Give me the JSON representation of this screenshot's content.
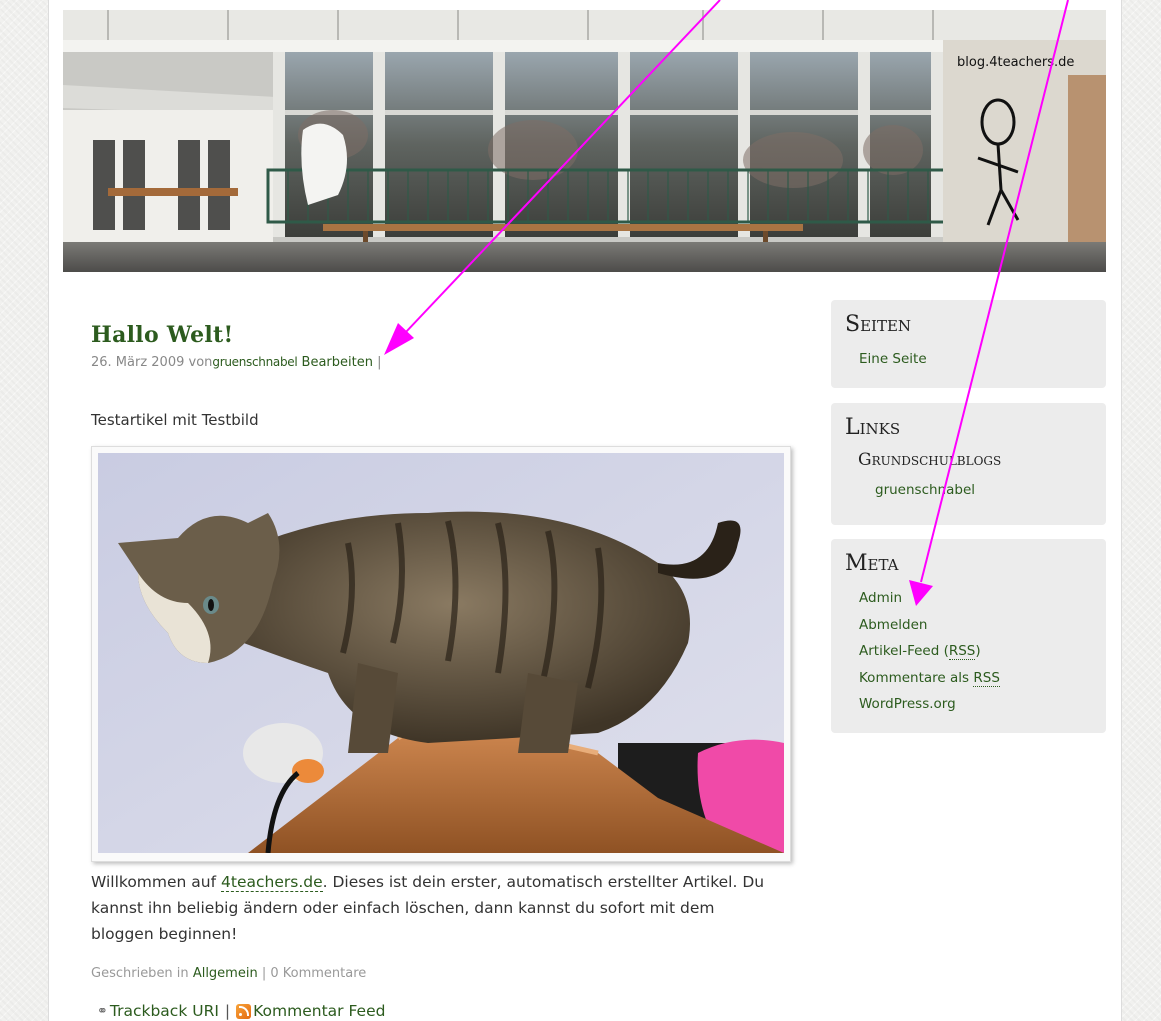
{
  "header": {
    "blog_name": "blog.4teachers.de"
  },
  "post": {
    "title": "Hallo Welt!",
    "date": "26. März 2009",
    "by": "von",
    "author": "gruenschnabel",
    "edit_label": "Bearbeiten",
    "meta_sep": "|",
    "intro": "Testartikel mit Testbild",
    "body_prefix": "Willkommen auf ",
    "body_link": "4teachers.de",
    "body_suffix": ". Dieses ist dein erster, automatisch erstellter Artikel. Du kannst ihn beliebig ändern oder einfach löschen, dann kannst du sofort mit dem bloggen beginnen!",
    "footer_prefix": "Geschrieben in",
    "category": "Allgemein",
    "footer_sep": "|",
    "comments": "0 Kommentare",
    "trackback_label": "Trackback URI",
    "trackback_sep": "|",
    "comment_feed_label": "Kommentar Feed",
    "icons": {
      "trackback": "link-icon",
      "comment_feed": "rss-icon"
    }
  },
  "sidebar": {
    "pages": {
      "title": "Seiten",
      "items": [
        "Eine Seite"
      ]
    },
    "links": {
      "title": "Links",
      "category": "Grundschulblogs",
      "items": [
        "gruenschnabel"
      ]
    },
    "meta": {
      "title": "Meta",
      "admin": "Admin",
      "logout": "Abmelden",
      "article_feed_prefix": "Artikel-Feed (",
      "article_feed_abbr": "RSS",
      "article_feed_suffix": ")",
      "comments_prefix": "Kommentare als ",
      "comments_abbr": "RSS",
      "wordpress": "WordPress.org"
    }
  },
  "colors": {
    "link": "#2c5b1e",
    "annotation_arrow": "#ff00ff",
    "widget_bg": "#ececec"
  }
}
